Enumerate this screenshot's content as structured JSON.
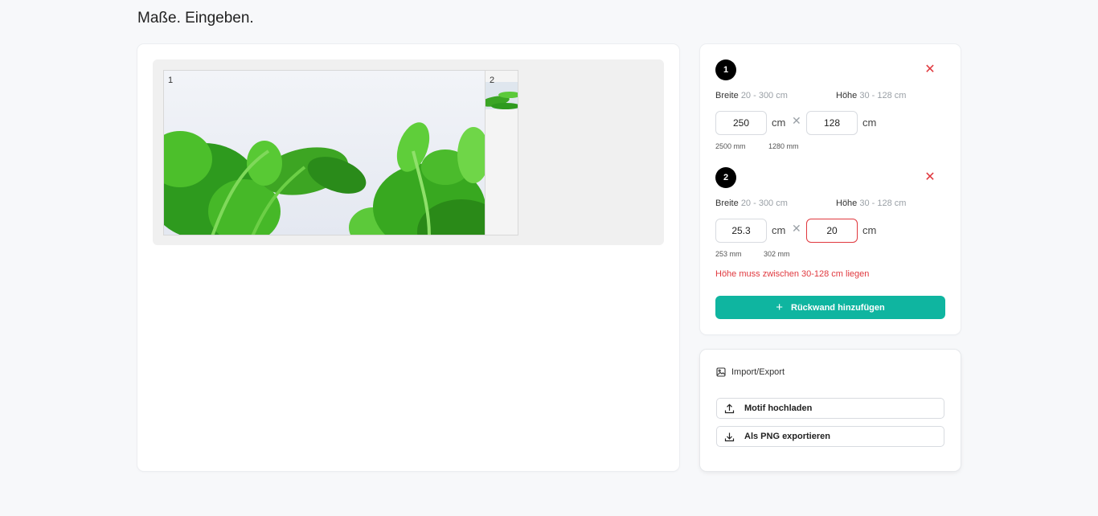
{
  "page": {
    "title": "Maße. Eingeben."
  },
  "preview": {
    "panels": [
      {
        "number": "1"
      },
      {
        "number": "2"
      }
    ]
  },
  "walls": [
    {
      "number": "1",
      "width_label": "Breite",
      "width_range": "20 - 300 cm",
      "height_label": "Höhe",
      "height_range": "30 - 128 cm",
      "width_value": "250",
      "height_value": "128",
      "unit": "cm",
      "width_mm": "2500 mm",
      "height_mm": "1280 mm"
    },
    {
      "number": "2",
      "width_label": "Breite",
      "width_range": "20 - 300 cm",
      "height_label": "Höhe",
      "height_range": "30 - 128 cm",
      "width_value": "25.3",
      "height_value": "20",
      "unit": "cm",
      "width_mm": "253 mm",
      "height_mm": "302 mm",
      "error": "Höhe muss zwischen 30-128 cm liegen"
    }
  ],
  "actions": {
    "add_wall": "Rückwand hinzufügen"
  },
  "import_export": {
    "title": "Import/Export",
    "upload": "Motif hochladen",
    "export": "Als PNG exportieren"
  },
  "colors": {
    "accent": "#0fb5a0",
    "error": "#e0383e"
  }
}
